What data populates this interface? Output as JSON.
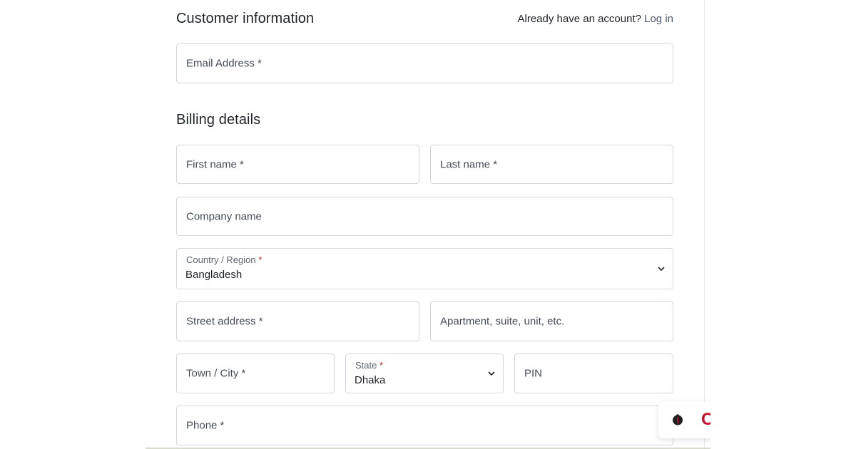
{
  "customer_info": {
    "title": "Customer information",
    "account_prompt": "Already have an account?",
    "login_link": "Log in",
    "email_placeholder": "Email Address *"
  },
  "billing": {
    "title": "Billing details",
    "first_name_placeholder": "First name *",
    "last_name_placeholder": "Last name *",
    "company_placeholder": "Company name",
    "country_label": "Country / Region",
    "country_required_mark": "*",
    "country_value": "Bangladesh",
    "street_placeholder": "Street address *",
    "apartment_placeholder": "Apartment, suite, unit, etc.",
    "city_placeholder": "Town / City *",
    "state_label": "State",
    "state_required_mark": "*",
    "state_value": "Dhaka",
    "pin_placeholder": "PIN",
    "phone_placeholder": "Phone *"
  },
  "toast": {
    "letter": "C"
  },
  "colors": {
    "required": "#c0272d",
    "border": "#d4d8de",
    "toast_accent": "#c8102e"
  }
}
